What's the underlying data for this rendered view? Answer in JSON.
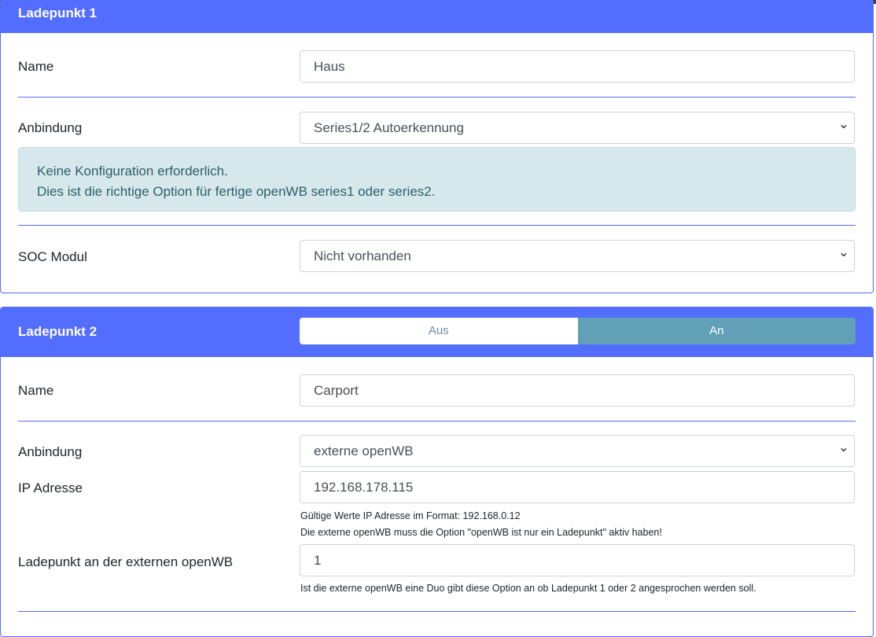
{
  "lp1": {
    "title": "Ladepunkt 1",
    "name_label": "Name",
    "name_value": "Haus",
    "anbindung_label": "Anbindung",
    "anbindung_value": "Series1/2 Autoerkennung",
    "info_line1": "Keine Konfiguration erforderlich.",
    "info_line2": "Dies ist die richtige Option für fertige openWB series1 oder series2.",
    "soc_label": "SOC Modul",
    "soc_value": "Nicht vorhanden"
  },
  "lp2": {
    "title": "Ladepunkt 2",
    "toggle_off": "Aus",
    "toggle_on": "An",
    "toggle_state": "An",
    "name_label": "Name",
    "name_value": "Carport",
    "anbindung_label": "Anbindung",
    "anbindung_value": "externe openWB",
    "ip_label": "IP Adresse",
    "ip_value": "192.168.178.115",
    "ip_help1": "Gültige Werte IP Adresse im Format: 192.168.0.12",
    "ip_help2": "Die externe openWB muss die Option \"openWB ist nur ein Ladepunkt\" aktiv haben!",
    "ext_label": "Ladepunkt an der externen openWB",
    "ext_value": "1",
    "ext_help": "Ist die externe openWB eine Duo gibt diese Option an ob Ladepunkt 1 oder 2 angesprochen werden soll."
  },
  "colors": {
    "primary": "#536dfe",
    "toggle_on": "#62a0b8",
    "info_bg": "#d6e8ec"
  }
}
